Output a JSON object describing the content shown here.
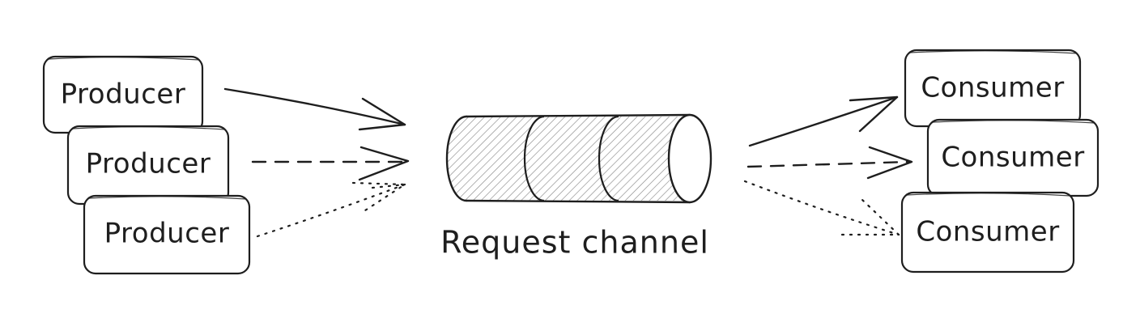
{
  "producers": [
    {
      "label": "Producer"
    },
    {
      "label": "Producer"
    },
    {
      "label": "Producer"
    }
  ],
  "consumers": [
    {
      "label": "Consumer"
    },
    {
      "label": "Consumer"
    },
    {
      "label": "Consumer"
    }
  ],
  "channel": {
    "label": "Request channel"
  },
  "arrow_styles": [
    "solid",
    "dashed",
    "dotted"
  ]
}
